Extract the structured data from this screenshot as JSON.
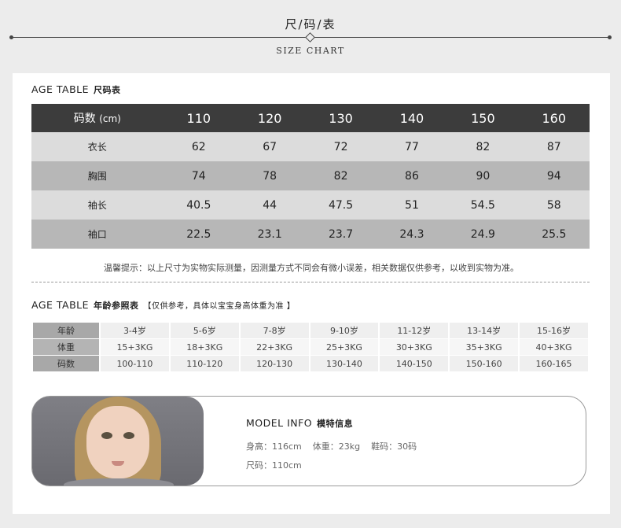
{
  "header": {
    "title": "尺/码/表",
    "subtitle": "SIZE CHART"
  },
  "size_table": {
    "title": "AGE TABLE",
    "title_cn": "尺码表",
    "head_label": "码数",
    "head_unit": "(cm)",
    "sizes": [
      "110",
      "120",
      "130",
      "140",
      "150",
      "160"
    ],
    "rows": [
      {
        "label": "衣长",
        "values": [
          "62",
          "67",
          "72",
          "77",
          "82",
          "87"
        ]
      },
      {
        "label": "胸围",
        "values": [
          "74",
          "78",
          "82",
          "86",
          "90",
          "94"
        ]
      },
      {
        "label": "袖长",
        "values": [
          "40.5",
          "44",
          "47.5",
          "51",
          "54.5",
          "58"
        ]
      },
      {
        "label": "袖口",
        "values": [
          "22.5",
          "23.1",
          "23.7",
          "24.3",
          "24.9",
          "25.5"
        ]
      }
    ],
    "tip": "温馨提示：以上尺寸为实物实际测量，因测量方式不同会有微小误差，相关数据仅供参考，以收到实物为准。"
  },
  "age_table": {
    "title": "AGE TABLE",
    "title_cn": "年龄参照表",
    "note": "【仅供参考，具体以宝宝身高体重为准 】",
    "rows": [
      {
        "label": "年龄",
        "values": [
          "3-4岁",
          "5-6岁",
          "7-8岁",
          "9-10岁",
          "11-12岁",
          "13-14岁",
          "15-16岁"
        ]
      },
      {
        "label": "体重",
        "values": [
          "15+3KG",
          "18+3KG",
          "22+3KG",
          "25+3KG",
          "30+3KG",
          "35+3KG",
          "40+3KG"
        ]
      },
      {
        "label": "码数",
        "values": [
          "100-110",
          "110-120",
          "120-130",
          "130-140",
          "140-150",
          "150-160",
          "160-165"
        ]
      }
    ]
  },
  "model": {
    "title": "MODEL INFO",
    "title_cn": "模特信息",
    "height": "身高：116cm",
    "weight": "体重：23kg",
    "shoe": "鞋码：30码",
    "size": "尺码：110cm"
  }
}
